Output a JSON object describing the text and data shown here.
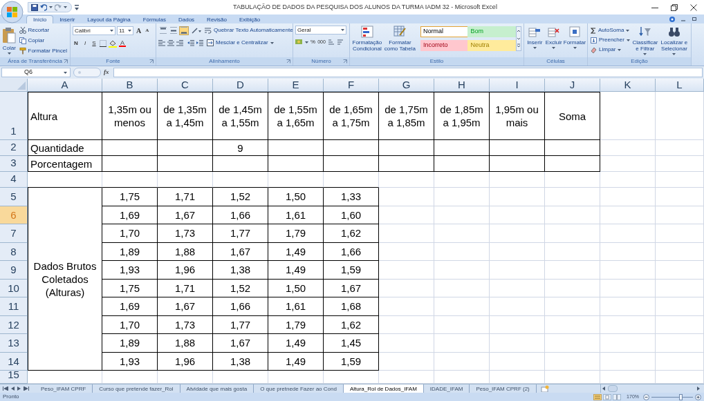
{
  "window": {
    "title": "TABULAÇÃO DE DADOS DA PESQUISA DOS ALUNOS DA TURMA IADM 32 - Microsoft Excel"
  },
  "ribbon_tabs": [
    {
      "label": "Início",
      "selected": true
    },
    {
      "label": "Inserir",
      "selected": false
    },
    {
      "label": "Layout da Página",
      "selected": false
    },
    {
      "label": "Fórmulas",
      "selected": false
    },
    {
      "label": "Dados",
      "selected": false
    },
    {
      "label": "Revisão",
      "selected": false
    },
    {
      "label": "Exibição",
      "selected": false
    }
  ],
  "clipboard": {
    "paste": "Colar",
    "cut": "Recortar",
    "copy": "Copiar",
    "format_painter": "Formatar Pincel",
    "label": "Área de Transferência"
  },
  "font": {
    "name": "Calibri",
    "size": "11",
    "grow": "A",
    "shrink": "A",
    "bold": "N",
    "italic": "I",
    "underline": "S",
    "color_button": "A",
    "label": "Fonte"
  },
  "alignment": {
    "vertical": [
      {
        "kind": "top",
        "selected": false
      },
      {
        "kind": "middle",
        "selected": false
      },
      {
        "kind": "bottom",
        "selected": true
      }
    ],
    "wrap_text": "Quebrar Texto Automaticamente",
    "merge": "Mesclar e Centralizar",
    "label": "Alinhamento"
  },
  "number": {
    "format": "Geral",
    "percent": "%",
    "thousands": "000",
    "label": "Número"
  },
  "styles": {
    "conditional": "Formatação\nCondicional",
    "as_table": "Formatar\ncomo Tabela",
    "gallery": [
      {
        "label": "Normal",
        "color": "#ffffff",
        "selected": true
      },
      {
        "label": "Bom",
        "color": "#c6efce",
        "selected": false
      },
      {
        "label": "Incorreto",
        "color": "#ffc7ce",
        "selected": false
      },
      {
        "label": "Neutra",
        "color": "#ffeb9c",
        "selected": false
      }
    ],
    "label": "Estilo"
  },
  "cells": {
    "insert": "Inserir",
    "delete": "Excluir",
    "format": "Formatar",
    "label": "Células"
  },
  "editing": {
    "autosum": "AutoSoma",
    "fill": "Preencher",
    "clear": "Limpar",
    "sort": "Classificar\ne Filtrar",
    "find": "Localizar e\nSelecionar",
    "label": "Edição"
  },
  "formula_bar": {
    "name_box": "Q6",
    "fx": "fx"
  },
  "sheet": {
    "columns": [
      "A",
      "B",
      "C",
      "D",
      "E",
      "F",
      "G",
      "H",
      "I",
      "J",
      "K",
      "L"
    ],
    "rows": [
      {
        "label": "1",
        "selected": false
      },
      {
        "label": "2",
        "selected": false
      },
      {
        "label": "3",
        "selected": false
      },
      {
        "label": "4",
        "selected": false
      },
      {
        "label": "5",
        "selected": false
      },
      {
        "label": "6",
        "selected": true
      },
      {
        "label": "7",
        "selected": false
      },
      {
        "label": "8",
        "selected": false
      },
      {
        "label": "9",
        "selected": false
      },
      {
        "label": "10",
        "selected": false
      },
      {
        "label": "11",
        "selected": false
      },
      {
        "label": "12",
        "selected": false
      },
      {
        "label": "13",
        "selected": false
      },
      {
        "label": "14",
        "selected": false
      },
      {
        "label": "15",
        "selected": false
      }
    ],
    "header_table": [
      {
        "A": "Altura",
        "B": "1,35m ou\nmenos",
        "C": "de 1,35m\na 1,45m",
        "D": "de 1,45m\na 1,55m",
        "E": "de 1,55m\na 1,65m",
        "F": "de 1,65m\na 1,75m",
        "G": "de 1,75m\na 1,85m",
        "H": "de 1,85m\na 1,95m",
        "I": "1,95m ou\nmais",
        "J": "Soma"
      },
      {
        "A": "Quantidade",
        "D": "9"
      },
      {
        "A": "Porcentagem"
      }
    ],
    "raw_data": {
      "label": "Dados Brutos\nColetados\n(Alturas)",
      "rows": [
        [
          "1,75",
          "1,71",
          "1,52",
          "1,50",
          "1,33"
        ],
        [
          "1,69",
          "1,67",
          "1,66",
          "1,61",
          "1,60"
        ],
        [
          "1,70",
          "1,73",
          "1,77",
          "1,79",
          "1,62"
        ],
        [
          "1,89",
          "1,88",
          "1,67",
          "1,49",
          "1,66"
        ],
        [
          "1,93",
          "1,96",
          "1,38",
          "1,49",
          "1,59"
        ],
        [
          "1,75",
          "1,71",
          "1,52",
          "1,50",
          "1,67"
        ],
        [
          "1,69",
          "1,67",
          "1,66",
          "1,61",
          "1,68"
        ],
        [
          "1,70",
          "1,73",
          "1,77",
          "1,79",
          "1,62"
        ],
        [
          "1,89",
          "1,88",
          "1,67",
          "1,49",
          "1,45"
        ],
        [
          "1,93",
          "1,96",
          "1,38",
          "1,49",
          "1,59"
        ]
      ]
    }
  },
  "sheet_tabs": [
    {
      "label": "Peso_IFAM CPRF",
      "selected": false
    },
    {
      "label": "Curso que pretende fazer_Rol",
      "selected": false
    },
    {
      "label": "Atvidade que mais gosta",
      "selected": false
    },
    {
      "label": "O que pretnede Fazer ao Cond",
      "selected": false
    },
    {
      "label": "Altura_Rol de Dados_IFAM",
      "selected": true
    },
    {
      "label": "IDADE_IFAM",
      "selected": false
    },
    {
      "label": "Peso_IFAM CPRF (2)",
      "selected": false
    }
  ],
  "status_bar": {
    "text": "Pronto",
    "zoom": "170%",
    "zoom_slider": {
      "level": 0.7
    }
  }
}
